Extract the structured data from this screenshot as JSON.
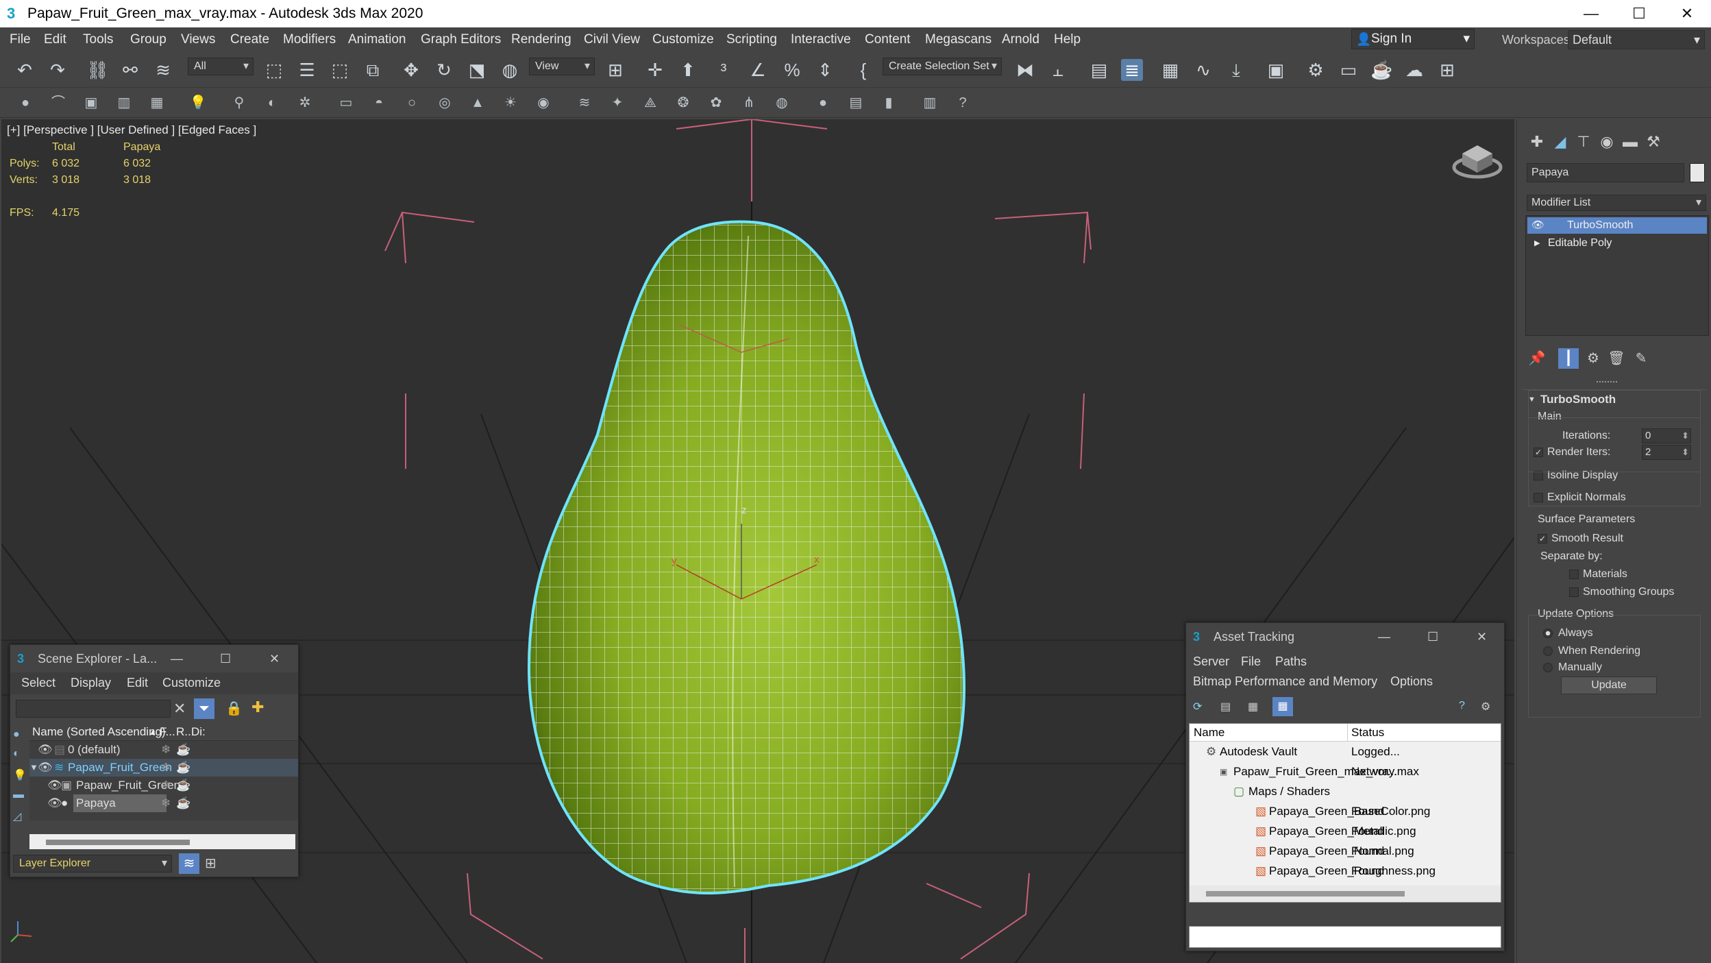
{
  "window": {
    "title": "Papaw_Fruit_Green_max_vray.max - Autodesk 3ds Max 2020",
    "logo": "3",
    "minimize_icon": "—",
    "maximize_icon": "☐",
    "close_icon": "✕"
  },
  "menu": [
    "File",
    "Edit",
    "Tools",
    "Group",
    "Views",
    "Create",
    "Modifiers",
    "Animation",
    "Graph Editors",
    "Rendering",
    "Civil View",
    "Customize",
    "Scripting",
    "Interactive",
    "Content",
    "Megascans",
    "Arnold",
    "Help"
  ],
  "signin": "Sign In",
  "workspaces": {
    "label": "Workspaces:",
    "value": "Default"
  },
  "toolbar": {
    "selection_filter": "All",
    "ref_coord": "View",
    "selection_set": "Create Selection Set",
    "icons": [
      "undo-icon",
      "redo-icon",
      "link-icon",
      "unlink-icon",
      "bind-spacewarp-icon",
      "select-object-icon",
      "select-by-name-icon",
      "rect-region-icon",
      "window-crossing-icon",
      "move-icon",
      "rotate-icon",
      "scale-icon",
      "place-icon",
      "pivot-icon",
      "select-manip-icon",
      "snap-3d-icon",
      "angle-snap-icon",
      "percent-snap-icon",
      "spinner-snap-icon",
      "edit-named-sel-icon",
      "mirror-icon",
      "align-icon",
      "scene-explorer-icon",
      "layer-explorer-icon",
      "toggle-ribbon-icon",
      "curve-editor-icon",
      "schematic-icon",
      "material-editor-icon",
      "render-setup-icon",
      "rendered-frame-icon",
      "render-icon",
      "render-iterative-icon",
      "render-online-icon"
    ]
  },
  "viewport": {
    "label": "[+] [Perspective ] [User Defined ] [Edged Faces ]",
    "stats": {
      "col_total": "Total",
      "col_object": "Papaya",
      "polys_label": "Polys:",
      "polys_total": "6 032",
      "polys_obj": "6 032",
      "verts_label": "Verts:",
      "verts_total": "3 018",
      "verts_obj": "3 018",
      "fps_label": "FPS:",
      "fps_value": "4.175"
    },
    "gizmo_z": "z",
    "gizmo_x": "x",
    "gizmo_y": "y"
  },
  "scene_explorer": {
    "title": "Scene Explorer - La...",
    "menu": [
      "Select",
      "Display",
      "Edit",
      "Customize"
    ],
    "columns": {
      "name": "Name (Sorted Ascending)",
      "frozen": "F...",
      "render": "R...",
      "display": "Di:"
    },
    "rows": [
      "0 (default)",
      "Papaw_Fruit_Green",
      "Papaw_Fruit_Green",
      "Papaya"
    ],
    "footer_mode": "Layer Explorer"
  },
  "asset_tracking": {
    "title": "Asset Tracking",
    "menu": [
      "Server",
      "File",
      "Paths"
    ],
    "menu2": [
      "Bitmap Performance and Memory",
      "Options"
    ],
    "columns": {
      "name": "Name",
      "status": "Status"
    },
    "rows": [
      {
        "name": "Autodesk Vault",
        "status": "Logged..."
      },
      {
        "name": "Papaw_Fruit_Green_max_vray.max",
        "status": "Networ..."
      },
      {
        "name": "Maps / Shaders",
        "status": ""
      },
      {
        "name": "Papaya_Green_BaseColor.png",
        "status": "Found"
      },
      {
        "name": "Papaya_Green_Metallic.png",
        "status": "Found"
      },
      {
        "name": "Papaya_Green_Normal.png",
        "status": "Found"
      },
      {
        "name": "Papaya_Green_Roughness.png",
        "status": "Found"
      }
    ]
  },
  "command_panel": {
    "object_name": "Papaya",
    "object_color": "#e8e8e8",
    "modifier_list": "Modifier List",
    "stack": [
      "TurboSmooth",
      "Editable Poly"
    ],
    "rollout_title": "TurboSmooth",
    "main_label": "Main",
    "iterations_label": "Iterations:",
    "iterations_value": "0",
    "render_iters_label": "Render Iters:",
    "render_iters_value": "2",
    "isoline_label": "Isoline Display",
    "explicit_normals_label": "Explicit Normals",
    "surface_params_label": "Surface Parameters",
    "smooth_result_label": "Smooth Result",
    "separate_by_label": "Separate by:",
    "materials_label": "Materials",
    "smoothing_groups_label": "Smoothing Groups",
    "update_options_label": "Update Options",
    "always_label": "Always",
    "when_rendering_label": "When Rendering",
    "manually_label": "Manually",
    "update_button": "Update"
  },
  "colors": {
    "accent": "#5b84c4",
    "stat_yellow": "#e6d36a",
    "selection_cyan": "#6fe4ff",
    "bounding_box": "#c8607a",
    "papaya_green": "#8fb52c"
  }
}
